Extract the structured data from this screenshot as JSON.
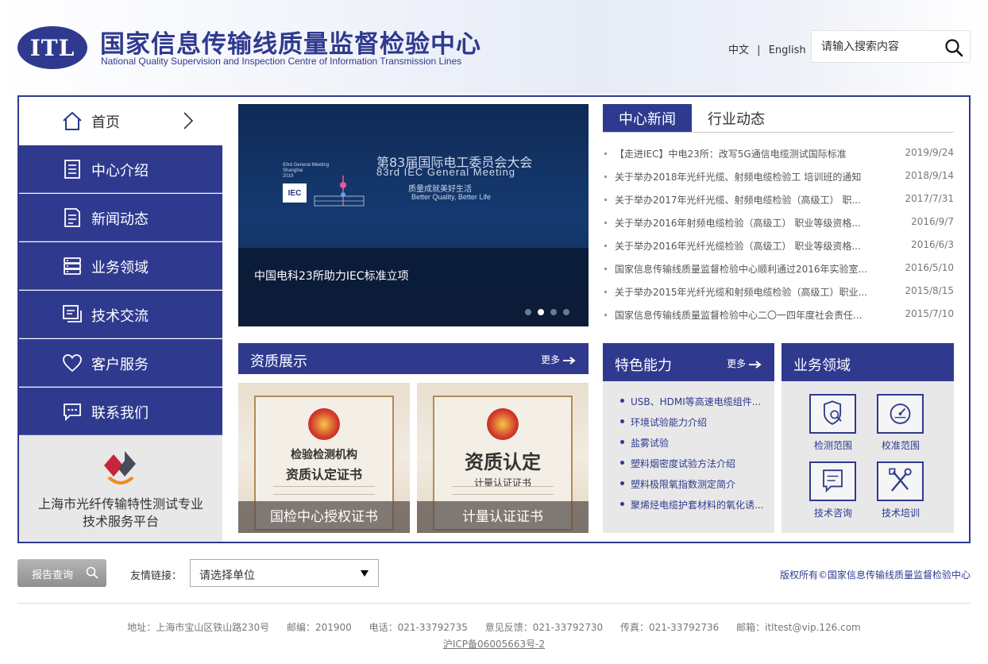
{
  "header": {
    "logo_text": "ITL",
    "title": "国家信息传输线质量监督检验中心",
    "subtitle": "National Quality Supervision and Inspection Centre of Information Transmission Lines",
    "lang_cn": "中文",
    "lang_sep": "|",
    "lang_en": "English",
    "search_placeholder": "请输入搜索内容"
  },
  "sidebar": {
    "items": [
      {
        "label": "首页",
        "icon": "home-icon"
      },
      {
        "label": "中心介绍",
        "icon": "document-icon"
      },
      {
        "label": "新闻动态",
        "icon": "news-icon"
      },
      {
        "label": "业务领域",
        "icon": "server-icon"
      },
      {
        "label": "技术交流",
        "icon": "chat-icon"
      },
      {
        "label": "客户服务",
        "icon": "heart-icon"
      },
      {
        "label": "联系我们",
        "icon": "message-icon"
      }
    ],
    "platform_line1": "上海市光纤传输特性测试专业",
    "platform_line2": "技术服务平台"
  },
  "banner": {
    "caption": "中国电科23所助力IEC标准立项",
    "title_cn": "第83届国际电工委员会大会",
    "title_en": "83rd IEC General Meeting",
    "slogan_cn": "质量成就美好生活",
    "slogan_en": "Better Quality, Better Life",
    "meeting_line1": "83rd General Meeting",
    "meeting_line2": "Shanghai",
    "meeting_line3": "2019",
    "iec_label": "IEC",
    "dots": 4,
    "active_dot": 2
  },
  "news": {
    "tab_active": "中心新闻",
    "tab_inactive": "行业动态",
    "items": [
      {
        "title": "【走进IEC】中电23所：改写5G通信电缆测试国际标准",
        "date": "2019/9/24"
      },
      {
        "title": "关于举办2018年光纤光缆、射频电缆检验工 培训班的通知",
        "date": "2018/9/14"
      },
      {
        "title": "关于举办2017年光纤光缆、射频电缆检验（高级工） 职...",
        "date": "2017/7/31"
      },
      {
        "title": "关于举办2016年射频电缆检验（高级工） 职业等级资格...",
        "date": "2016/9/7"
      },
      {
        "title": "关于举办2016年光纤光缆检验（高级工） 职业等级资格...",
        "date": "2016/6/3"
      },
      {
        "title": "国家信息传输线质量监督检验中心顺利通过2016年实验室...",
        "date": "2016/5/10"
      },
      {
        "title": "关于举办2015年光纤光缆和射频电缆检验（高级工）职业...",
        "date": "2015/8/15"
      },
      {
        "title": "国家信息传输线质量监督检验中心二〇一四年度社会责任...",
        "date": "2015/7/10"
      }
    ]
  },
  "qualification": {
    "title": "资质展示",
    "more": "更多",
    "certs": [
      {
        "caption": "国检中心授权证书",
        "heading1": "检验检测机构",
        "heading2": "资质认定证书"
      },
      {
        "caption": "计量认证证书",
        "heading1": "资质认定",
        "heading2": "计量认证证书"
      }
    ]
  },
  "features": {
    "title": "特色能力",
    "more": "更多",
    "items": [
      "USB、HDMI等高速电缆组件...",
      "环境试验能力介绍",
      "盐雾试验",
      "塑料烟密度试验方法介绍",
      "塑料极限氧指数测定简介",
      "聚烯烃电缆护套材料的氧化诱..."
    ]
  },
  "business": {
    "title": "业务领域",
    "items": [
      {
        "label": "检测范围",
        "icon": "shield-search-icon"
      },
      {
        "label": "校准范围",
        "icon": "gauge-icon"
      },
      {
        "label": "技术咨询",
        "icon": "consult-icon"
      },
      {
        "label": "技术培训",
        "icon": "tools-icon"
      }
    ]
  },
  "footer": {
    "report_label": "报告查询",
    "links_label": "友情链接：",
    "links_select": "请选择单位",
    "copyright": "版权所有©国家信息传输线质量监督检验中心",
    "address": "地址：上海市宝山区铁山路230号",
    "postcode": "邮编：201900",
    "phone": "电话：021-33792735",
    "feedback": "意见反馈：021-33792730",
    "fax": "传真：021-33792736",
    "email": "邮箱：itltest@vip.126.com",
    "icp": "沪ICP备06005663号-2"
  },
  "colors": {
    "brand": "#2f3a8f",
    "sidebar_bg": "#2f3a8f",
    "panel_gray": "#e8e8e8"
  }
}
